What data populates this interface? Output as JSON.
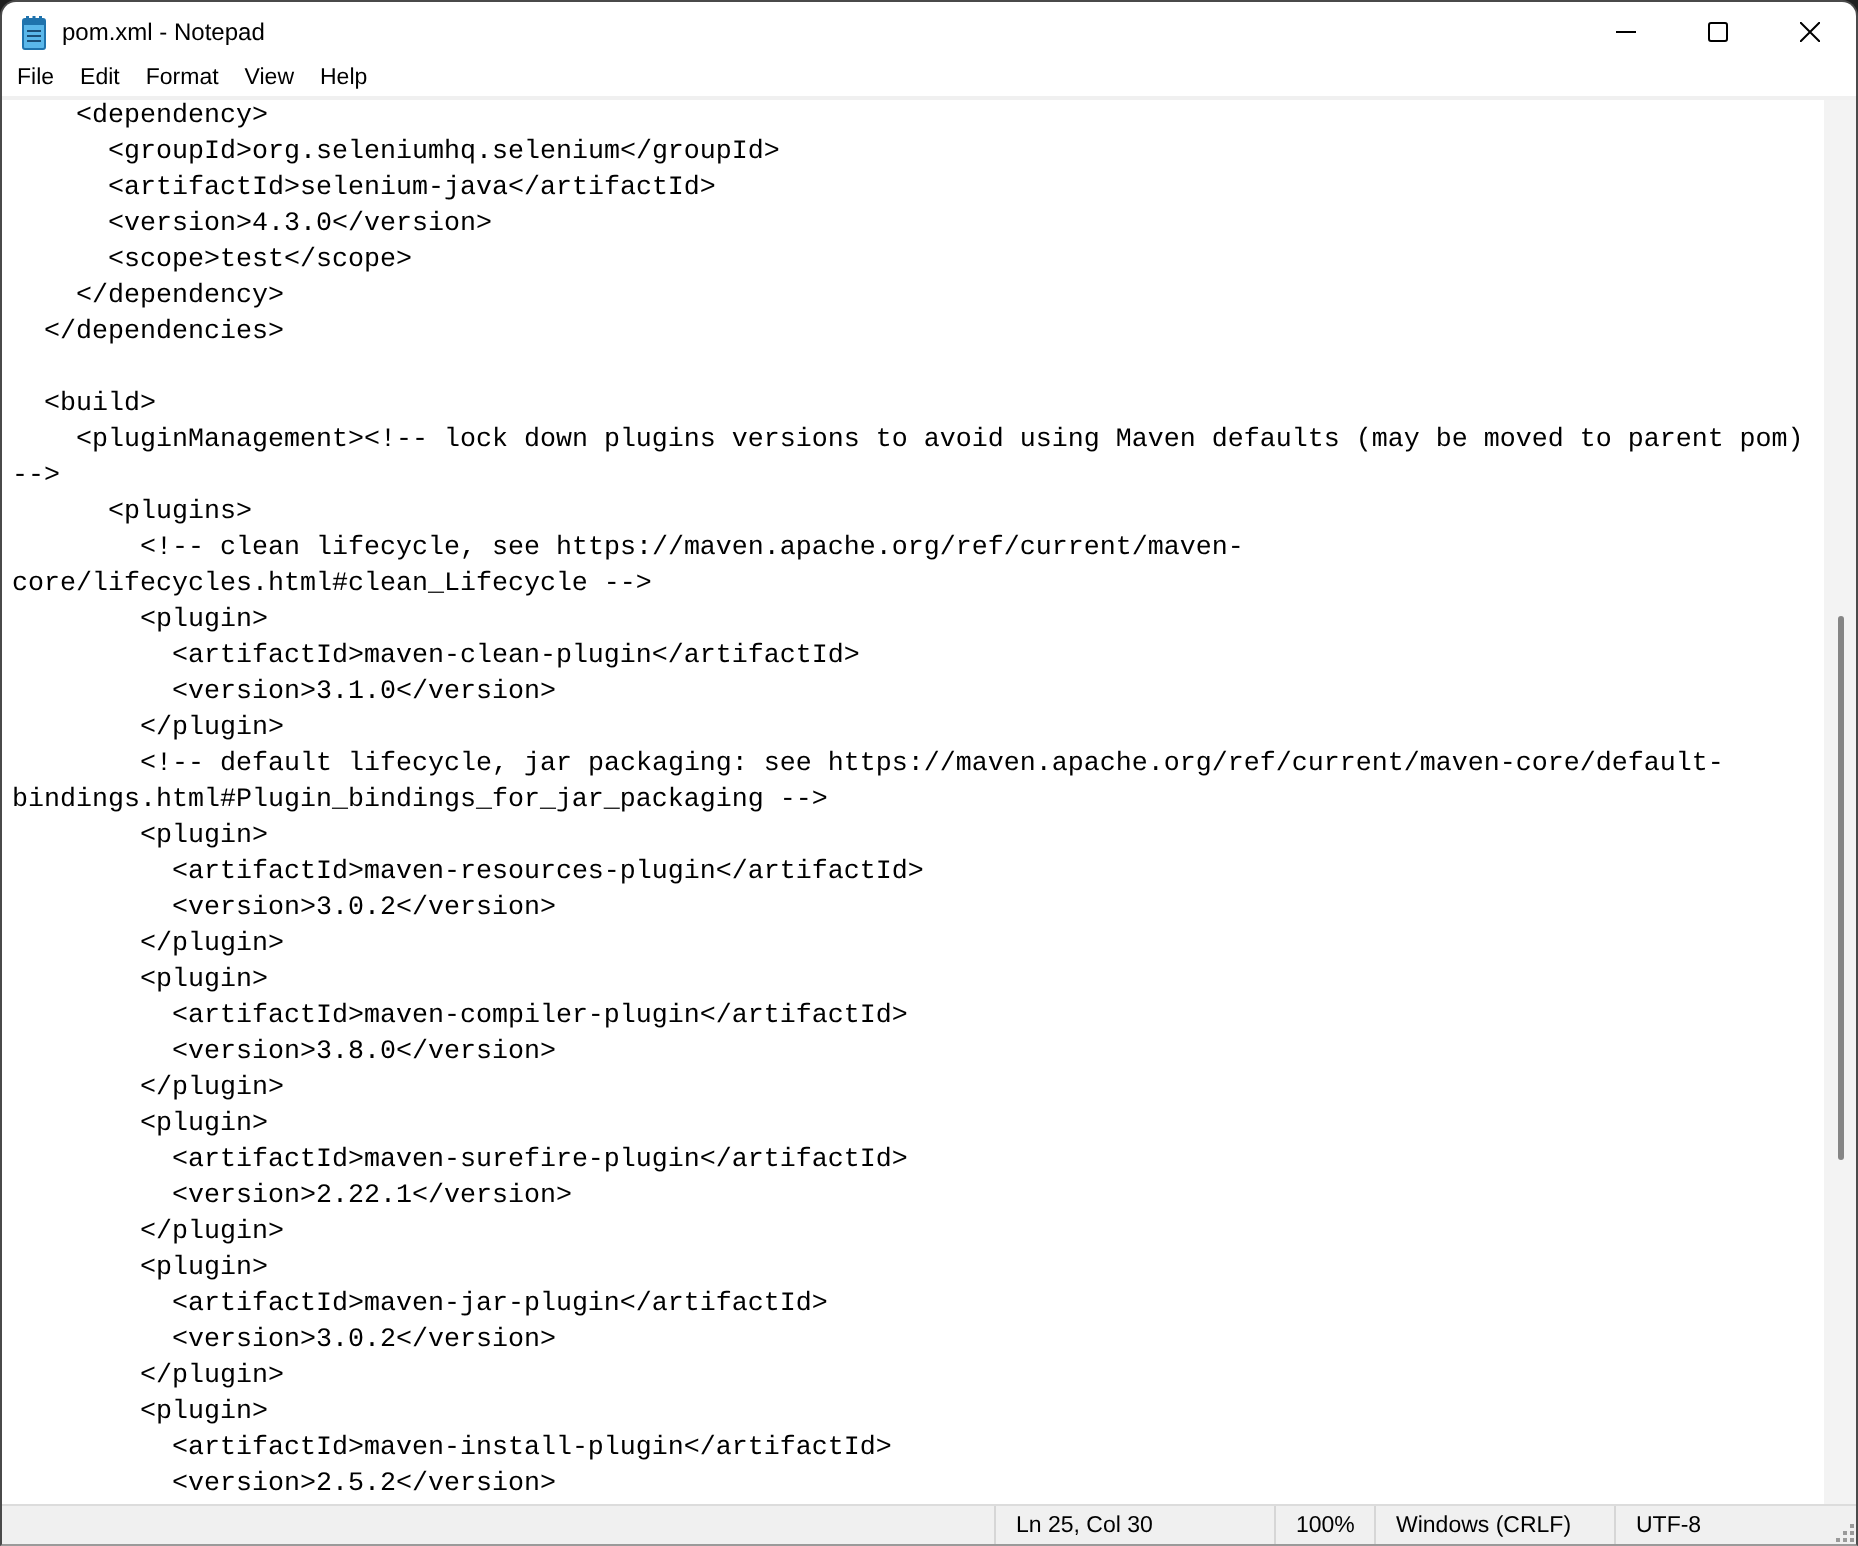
{
  "window": {
    "title": "pom.xml - Notepad"
  },
  "menu": [
    {
      "label": "File"
    },
    {
      "label": "Edit"
    },
    {
      "label": "Format"
    },
    {
      "label": "View"
    },
    {
      "label": "Help"
    }
  ],
  "editor": {
    "lines": [
      {
        "kind": "code",
        "text": "    <dependency>"
      },
      {
        "kind": "code",
        "text": "      <groupId>org.seleniumhq.selenium</groupId>"
      },
      {
        "kind": "code",
        "text": "      <artifactId>selenium-java</artifactId>"
      },
      {
        "kind": "code",
        "text": "      <version>4.3.0</version>"
      },
      {
        "kind": "code",
        "text": "      <scope>test</scope>"
      },
      {
        "kind": "code",
        "text": "    </dependency>"
      },
      {
        "kind": "code",
        "text": "  </dependencies>"
      },
      {
        "kind": "blank"
      },
      {
        "kind": "code",
        "text": "  <build>"
      },
      {
        "kind": "code",
        "text": "    <pluginManagement><!-- lock down plugins versions to avoid using Maven defaults (may be moved to parent pom)"
      },
      {
        "kind": "code",
        "text": "-->"
      },
      {
        "kind": "code",
        "text": "      <plugins>"
      },
      {
        "kind": "code",
        "text": "        <!-- clean lifecycle, see https://maven.apache.org/ref/current/maven-"
      },
      {
        "kind": "code",
        "text": "core/lifecycles.html#clean_Lifecycle -->"
      },
      {
        "kind": "code",
        "text": "        <plugin>"
      },
      {
        "kind": "code",
        "text": "          <artifactId>maven-clean-plugin</artifactId>"
      },
      {
        "kind": "code",
        "text": "          <version>3.1.0</version>"
      },
      {
        "kind": "code",
        "text": "        </plugin>"
      },
      {
        "kind": "code",
        "text": "        <!-- default lifecycle, jar packaging: see https://maven.apache.org/ref/current/maven-core/default-"
      },
      {
        "kind": "code",
        "text": "bindings.html#Plugin_bindings_for_jar_packaging -->"
      },
      {
        "kind": "code",
        "text": "        <plugin>"
      },
      {
        "kind": "code",
        "text": "          <artifactId>maven-resources-plugin</artifactId>"
      },
      {
        "kind": "code",
        "text": "          <version>3.0.2</version>"
      },
      {
        "kind": "code",
        "text": "        </plugin>"
      },
      {
        "kind": "code",
        "text": "        <plugin>"
      },
      {
        "kind": "code",
        "text": "          <artifactId>maven-compiler-plugin</artifactId>"
      },
      {
        "kind": "code",
        "text": "          <version>3.8.0</version>"
      },
      {
        "kind": "code",
        "text": "        </plugin>"
      },
      {
        "kind": "code",
        "text": "        <plugin>"
      },
      {
        "kind": "code",
        "text": "          <artifactId>maven-surefire-plugin</artifactId>"
      },
      {
        "kind": "code",
        "text": "          <version>2.22.1</version>"
      },
      {
        "kind": "code",
        "text": "        </plugin>"
      },
      {
        "kind": "code",
        "text": "        <plugin>"
      },
      {
        "kind": "code",
        "text": "          <artifactId>maven-jar-plugin</artifactId>"
      },
      {
        "kind": "code",
        "text": "          <version>3.0.2</version>"
      },
      {
        "kind": "code",
        "text": "        </plugin>"
      },
      {
        "kind": "code",
        "text": "        <plugin>"
      },
      {
        "kind": "code",
        "text": "          <artifactId>maven-install-plugin</artifactId>"
      },
      {
        "kind": "code",
        "text": "          <version>2.5.2</version>"
      }
    ]
  },
  "status_bar": {
    "position": "Ln 25, Col 30",
    "zoom": "100%",
    "line_ending": "Windows (CRLF)",
    "encoding": "UTF-8"
  }
}
